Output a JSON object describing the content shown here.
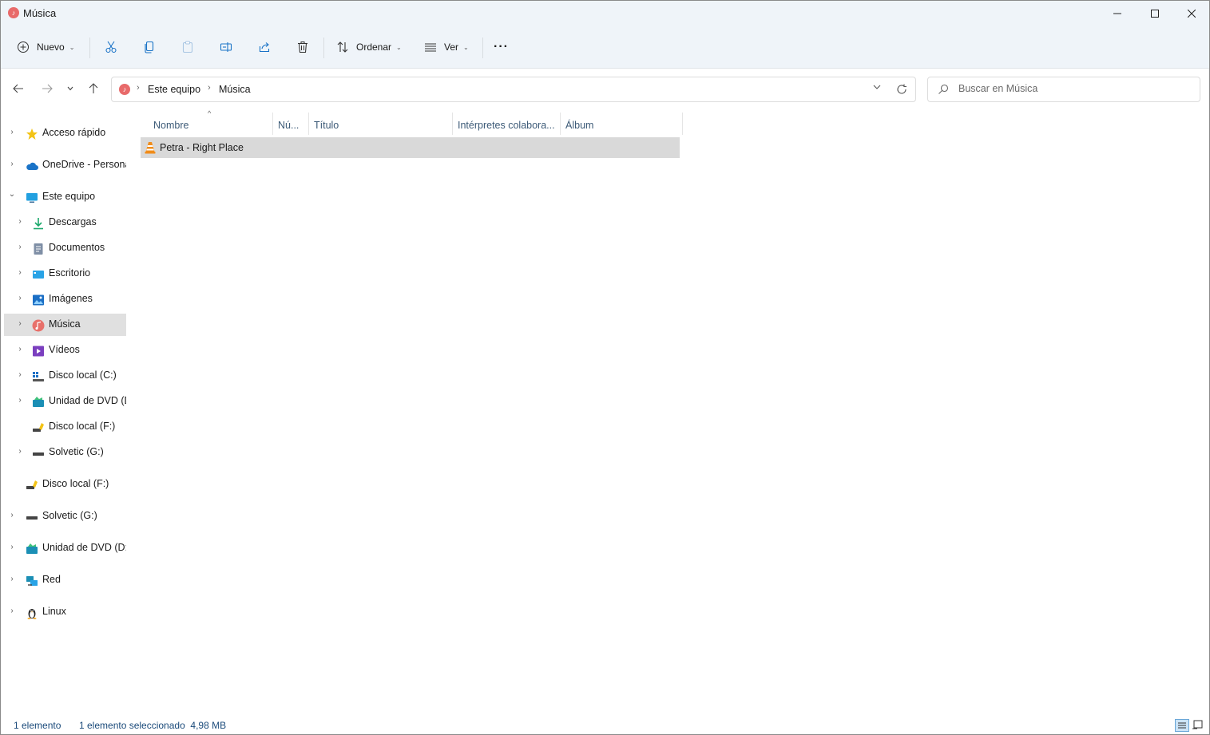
{
  "window": {
    "title": "Música"
  },
  "toolbar": {
    "new_label": "Nuevo",
    "sort_label": "Ordenar",
    "view_label": "Ver",
    "more_label": "···"
  },
  "address": {
    "crumbs": [
      "Este equipo",
      "Música"
    ]
  },
  "search": {
    "placeholder": "Buscar en Música"
  },
  "sidebar": {
    "items": [
      {
        "label": "Acceso rápido",
        "icon": "star-icon"
      },
      {
        "label": "OneDrive - Personal",
        "icon": "cloud-icon"
      },
      {
        "label": "Este equipo",
        "icon": "computer-icon"
      },
      {
        "label": "Descargas",
        "icon": "download-icon"
      },
      {
        "label": "Documentos",
        "icon": "document-icon"
      },
      {
        "label": "Escritorio",
        "icon": "desktop-icon"
      },
      {
        "label": "Imágenes",
        "icon": "pictures-icon"
      },
      {
        "label": "Música",
        "icon": "music-icon"
      },
      {
        "label": "Vídeos",
        "icon": "videos-icon"
      },
      {
        "label": "Disco local (C:)",
        "icon": "windows-drive-icon"
      },
      {
        "label": "Unidad de DVD (D:)",
        "icon": "dvd-icon"
      },
      {
        "label": "Disco local (F:)",
        "icon": "usb-drive-icon"
      },
      {
        "label": "Solvetic (G:)",
        "icon": "drive-icon"
      },
      {
        "label": "Disco local (F:)",
        "icon": "usb-drive-icon"
      },
      {
        "label": "Solvetic (G:)",
        "icon": "drive-icon"
      },
      {
        "label": "Unidad de DVD (D:)",
        "icon": "dvd-icon"
      },
      {
        "label": "Red",
        "icon": "network-icon"
      },
      {
        "label": "Linux",
        "icon": "linux-icon"
      }
    ]
  },
  "columns": [
    "Nombre",
    "Nú...",
    "Título",
    "Intérpretes colabora...",
    "Álbum"
  ],
  "files": [
    {
      "name": "Petra - Right Place",
      "icon": "vlc-icon"
    }
  ],
  "status": {
    "count": "1 elemento",
    "selection": "1 elemento seleccionado  4,98 MB"
  },
  "colors": {
    "accent": "#0067c0",
    "header_text": "#3c5a77",
    "selected_row": "#d9d9d9"
  }
}
